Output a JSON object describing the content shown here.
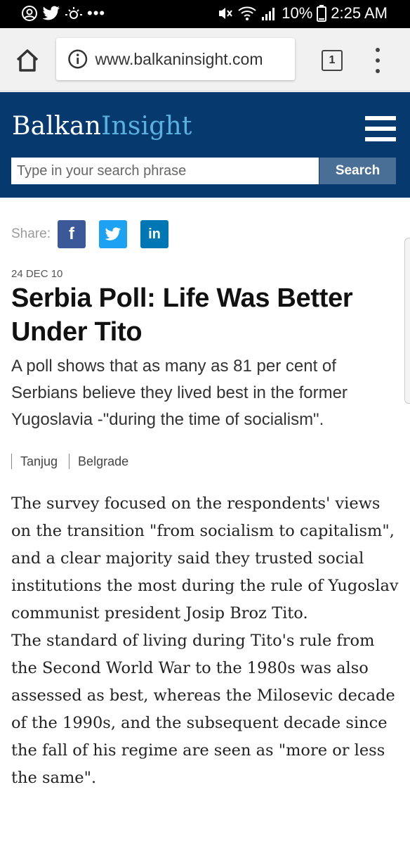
{
  "status_bar": {
    "battery": "10%",
    "time": "2:25 AM"
  },
  "browser": {
    "url": "www.balkaninsight.com",
    "tab_count": "1"
  },
  "site": {
    "logo_part1": "Balkan",
    "logo_part2": "Insight",
    "search_placeholder": "Type in your search phrase",
    "search_button": "Search"
  },
  "share": {
    "label": "Share:",
    "facebook": "f",
    "linkedin": "in"
  },
  "article": {
    "date": "24 DEC 10",
    "title": "Serbia Poll: Life Was Better Under Tito",
    "lead": "A poll shows that as many as 81 per cent of Serbians believe they lived best in the former Yugoslavia -\"during the time of socialism\".",
    "source": "Tanjug",
    "location": "Belgrade",
    "paragraph1": "The survey focused on the respondents' views on the transition \"from socialism to capitalism\", and a clear majority said they trusted social institutions the most during the rule of Yugoslav communist president Josip Broz Tito.",
    "paragraph2": "The standard of living during Tito's rule from the Second World War to the 1980s was also assessed as best, whereas the Milosevic decade of the 1990s, and the subsequent decade since the fall of his regime are seen as \"more or less the same\"."
  },
  "colors": {
    "header_bg": "#063a6e",
    "logo_accent": "#59b1e0",
    "search_button_bg": "#4a6f97",
    "facebook": "#3b5998",
    "twitter": "#1da1f2",
    "linkedin": "#0077b5"
  }
}
